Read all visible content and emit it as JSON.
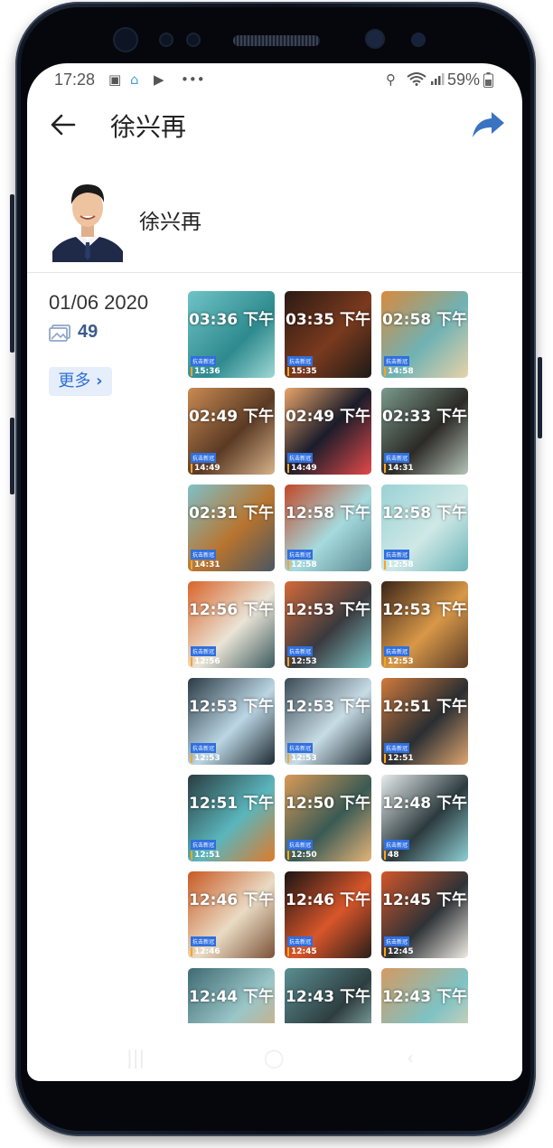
{
  "status_bar": {
    "time": "17:28",
    "battery": "59%"
  },
  "header": {
    "title": "徐兴再"
  },
  "profile": {
    "name": "徐兴再"
  },
  "album": {
    "date": "01/06 2020",
    "photo_count": "49",
    "more_label": "更多",
    "tag_label": "抗击新冠"
  },
  "photos": [
    {
      "time": "03:36 下午",
      "stamp": "15:36"
    },
    {
      "time": "03:35 下午",
      "stamp": "15:35"
    },
    {
      "time": "02:58 下午",
      "stamp": "14:58"
    },
    {
      "time": "02:49 下午",
      "stamp": "14:49"
    },
    {
      "time": "02:49 下午",
      "stamp": "14:49"
    },
    {
      "time": "02:33 下午",
      "stamp": "14:31"
    },
    {
      "time": "02:31 下午",
      "stamp": "14:31"
    },
    {
      "time": "12:58 下午",
      "stamp": "12:58"
    },
    {
      "time": "12:58 下午",
      "stamp": "12:58"
    },
    {
      "time": "12:56 下午",
      "stamp": "12:56"
    },
    {
      "time": "12:53 下午",
      "stamp": "12:53"
    },
    {
      "time": "12:53 下午",
      "stamp": "12:53"
    },
    {
      "time": "12:53 下午",
      "stamp": "12:53"
    },
    {
      "time": "12:53 下午",
      "stamp": "12:53"
    },
    {
      "time": "12:51 下午",
      "stamp": "12:51"
    },
    {
      "time": "12:51 下午",
      "stamp": "12:51"
    },
    {
      "time": "12:50 下午",
      "stamp": "12:50"
    },
    {
      "time": "12:48 下午",
      "stamp": "48"
    },
    {
      "time": "12:46 下午",
      "stamp": "12:46"
    },
    {
      "time": "12:46 下午",
      "stamp": "12:45"
    },
    {
      "time": "12:45 下午",
      "stamp": "12:45"
    },
    {
      "time": "12:44 下午",
      "stamp": ""
    },
    {
      "time": "12:43 下午",
      "stamp": ""
    },
    {
      "time": "12:43 下午",
      "stamp": ""
    }
  ],
  "colors": {
    "accent": "#2f6fd6",
    "count": "#3c5a8c",
    "tag": "#2f6fe0"
  },
  "icons": [
    "back-arrow-icon",
    "share-icon",
    "gallery-icon",
    "chevron-right-icon",
    "location-icon",
    "wifi-icon",
    "signal-icon",
    "battery-icon"
  ]
}
